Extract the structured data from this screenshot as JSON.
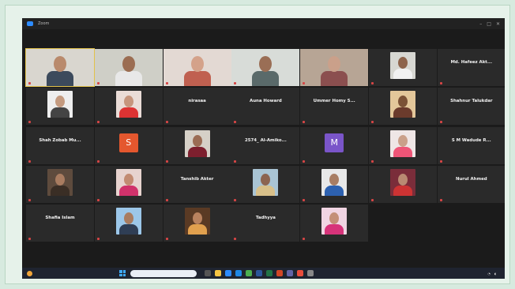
{
  "window": {
    "title": "Zoom"
  },
  "tiles": [
    {
      "id": "p1",
      "kind": "video",
      "caption": "",
      "active": true
    },
    {
      "id": "p2",
      "kind": "video",
      "caption": ""
    },
    {
      "id": "p3",
      "kind": "video",
      "caption": ""
    },
    {
      "id": "p4",
      "kind": "video",
      "caption": ""
    },
    {
      "id": "p5",
      "kind": "video",
      "caption": ""
    },
    {
      "id": "p6",
      "kind": "photo",
      "caption": ""
    },
    {
      "id": "p7",
      "kind": "name",
      "name": "Md. Hafeez Akt...",
      "caption": ""
    },
    {
      "id": "p8",
      "kind": "photo",
      "caption": ""
    },
    {
      "id": "p9",
      "kind": "photo",
      "caption": ""
    },
    {
      "id": "p10",
      "kind": "name",
      "name": "nirasaa",
      "caption": ""
    },
    {
      "id": "p11",
      "kind": "name",
      "name": "Auna Howard",
      "caption": ""
    },
    {
      "id": "p12",
      "kind": "name",
      "name": "Ummer Homy S...",
      "caption": ""
    },
    {
      "id": "p13",
      "kind": "photo",
      "caption": ""
    },
    {
      "id": "p14",
      "kind": "name",
      "name": "Shahnur Talukdar",
      "caption": ""
    },
    {
      "id": "p15",
      "kind": "name",
      "name": "Shah Zobab Mu...",
      "caption": ""
    },
    {
      "id": "p16",
      "kind": "initial",
      "initial": "S",
      "color": "#e4572e",
      "caption": ""
    },
    {
      "id": "p17",
      "kind": "photo",
      "caption": ""
    },
    {
      "id": "p18",
      "kind": "name",
      "name": "2574_ Al-Amiko...",
      "caption": ""
    },
    {
      "id": "p19",
      "kind": "initial",
      "initial": "M",
      "color": "#7a55c9",
      "caption": ""
    },
    {
      "id": "p20",
      "kind": "photo",
      "caption": ""
    },
    {
      "id": "p21",
      "kind": "name",
      "name": "S M Wadude R...",
      "caption": ""
    },
    {
      "id": "p22",
      "kind": "photo",
      "caption": ""
    },
    {
      "id": "p23",
      "kind": "photo",
      "caption": ""
    },
    {
      "id": "p24",
      "kind": "name",
      "name": "Tanshib Akter",
      "caption": ""
    },
    {
      "id": "p25",
      "kind": "photo",
      "caption": ""
    },
    {
      "id": "p26",
      "kind": "photo",
      "caption": ""
    },
    {
      "id": "p27",
      "kind": "photo",
      "caption": ""
    },
    {
      "id": "p28",
      "kind": "name",
      "name": "Nurul Ahmed",
      "caption": ""
    },
    {
      "id": "p29",
      "kind": "name",
      "name": "Shafia Islam",
      "caption": ""
    },
    {
      "id": "p30",
      "kind": "photo",
      "caption": ""
    },
    {
      "id": "p31",
      "kind": "photo",
      "caption": ""
    },
    {
      "id": "p32",
      "kind": "name",
      "name": "Tadhyya",
      "caption": ""
    },
    {
      "id": "p33",
      "kind": "photo",
      "caption": ""
    }
  ],
  "taskbar": {
    "search_placeholder": "",
    "clock": ""
  }
}
